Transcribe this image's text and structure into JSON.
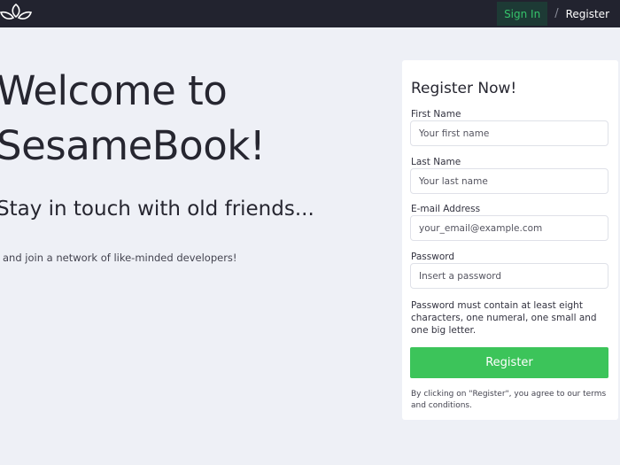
{
  "nav": {
    "signin_label": "Sign In",
    "separator": "/",
    "register_label": "Register"
  },
  "hero": {
    "title_line1": "Welcome to",
    "title_line2": "SesameBook!",
    "subtitle": "Stay in touch with old friends...",
    "note": "and join a network of like-minded developers!"
  },
  "form": {
    "title": "Register Now!",
    "fields": [
      {
        "label": "First Name",
        "placeholder": "Your first name"
      },
      {
        "label": "Last Name",
        "placeholder": "Your last name"
      },
      {
        "label": "E-mail Address",
        "placeholder": "your_email@example.com"
      },
      {
        "label": "Password",
        "placeholder": "Insert a password"
      }
    ],
    "password_hint": "Password must contain at least eight characters, one numeral, one small and one big letter.",
    "submit_label": "Register",
    "terms": "By clicking on \"Register\", you agree to our terms and conditions."
  },
  "colors": {
    "navbar_bg": "#22232f",
    "accent_green": "#3cc45a",
    "signin_text": "#35c36b",
    "page_bg": "#eef0f6"
  },
  "icons": {
    "logo": "sesame-leaves-icon"
  }
}
